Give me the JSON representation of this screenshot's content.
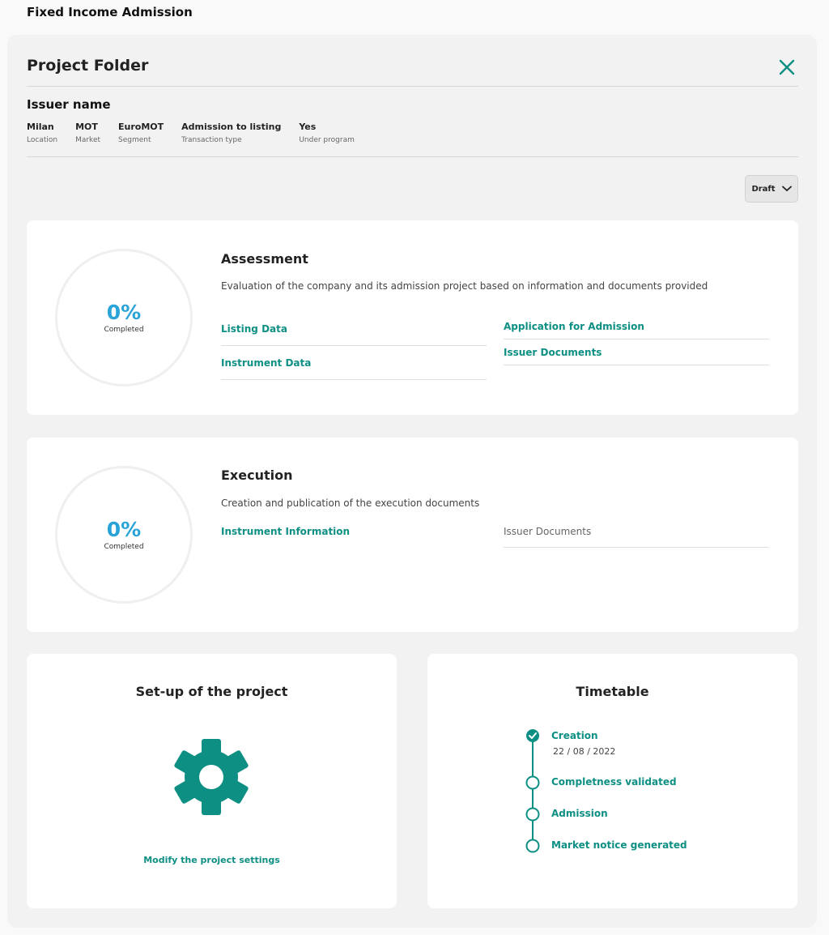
{
  "app": {
    "title": "Fixed Income Admission"
  },
  "panel": {
    "title": "Project Folder",
    "close_icon": "close-icon"
  },
  "issuer": {
    "name": "Issuer name",
    "meta": [
      {
        "value": "Milan",
        "label": "Location"
      },
      {
        "value": "MOT",
        "label": "Market"
      },
      {
        "value": "EuroMOT",
        "label": "Segment"
      },
      {
        "value": "Admission to listing",
        "label": "Transaction type"
      },
      {
        "value": "Yes",
        "label": "Under program"
      }
    ]
  },
  "status": {
    "selected": "Draft",
    "icon": "chevron-down-icon"
  },
  "assessment": {
    "progress": "0%",
    "progress_label": "Completed",
    "progress_value": 0,
    "title": "Assessment",
    "description": "Evaluation of the company and its admission project based on information and documents provided",
    "links_left": [
      "Listing Data",
      "Instrument Data"
    ],
    "links_right": [
      "Application for Admission",
      "Issuer Documents"
    ]
  },
  "execution": {
    "progress": "0%",
    "progress_label": "Completed",
    "progress_value": 0,
    "title": "Execution",
    "description": "Creation and publication of the execution documents",
    "link_left": "Instrument Information",
    "link_right": "Issuer Documents"
  },
  "setup": {
    "title": "Set-up of the project",
    "icon": "gear-icon",
    "link": "Modify the project settings"
  },
  "timetable": {
    "title": "Timetable",
    "steps": [
      {
        "label": "Creation",
        "date": "22 / 08 / 2022",
        "done": true
      },
      {
        "label": "Completness validated",
        "done": false
      },
      {
        "label": "Admission",
        "done": false
      },
      {
        "label": "Market notice generated",
        "done": false
      }
    ]
  },
  "colors": {
    "accent": "#0e8f84",
    "progress": "#2aa3d8"
  }
}
